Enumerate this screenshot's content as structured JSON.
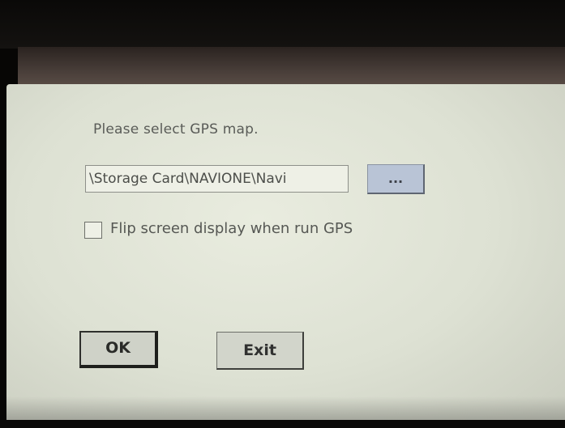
{
  "dialog": {
    "prompt": "Please select GPS map.",
    "map_path": "\\Storage Card\\NAVIONE\\Navi",
    "browse_label": "...",
    "flip_label": "Flip screen display when run GPS",
    "flip_checked": false,
    "ok_label": "OK",
    "exit_label": "Exit"
  },
  "colors": {
    "screen_background": "#dde1d3",
    "browse_button": "#b9c4d6",
    "text": "#5a5c58"
  }
}
